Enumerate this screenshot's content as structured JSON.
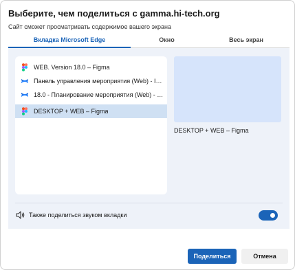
{
  "dialog": {
    "title": "Выберите, чем поделиться с gamma.hi-tech.org",
    "subtitle": "Сайт сможет просматривать содержимое вашего экрана"
  },
  "tabs": [
    {
      "label": "Вкладка Microsoft Edge",
      "active": true
    },
    {
      "label": "Окно",
      "active": false
    },
    {
      "label": "Весь экран",
      "active": false
    }
  ],
  "tab_list": [
    {
      "label": "WEB. Version 18.0 – Figma",
      "icon": "figma-icon",
      "selected": false
    },
    {
      "label": "Панель управления мероприятия (Web) - IVC...",
      "icon": "confluence-icon",
      "selected": false
    },
    {
      "label": "18.0 - Планирование мероприятия (Web) - IV...",
      "icon": "confluence-icon",
      "selected": false
    },
    {
      "label": "DESKTOP + WEB – Figma",
      "icon": "figma-icon",
      "selected": true
    }
  ],
  "preview": {
    "label": "DESKTOP + WEB – Figma"
  },
  "audio": {
    "label": "Также поделиться звуком вкладки",
    "enabled": true
  },
  "buttons": {
    "share": "Поделиться",
    "cancel": "Отмена"
  },
  "colors": {
    "accent": "#1b64b8",
    "panel_bg": "#eef2f9",
    "selected_row": "#cfe0f3",
    "preview_bg": "#d6e4fb"
  }
}
